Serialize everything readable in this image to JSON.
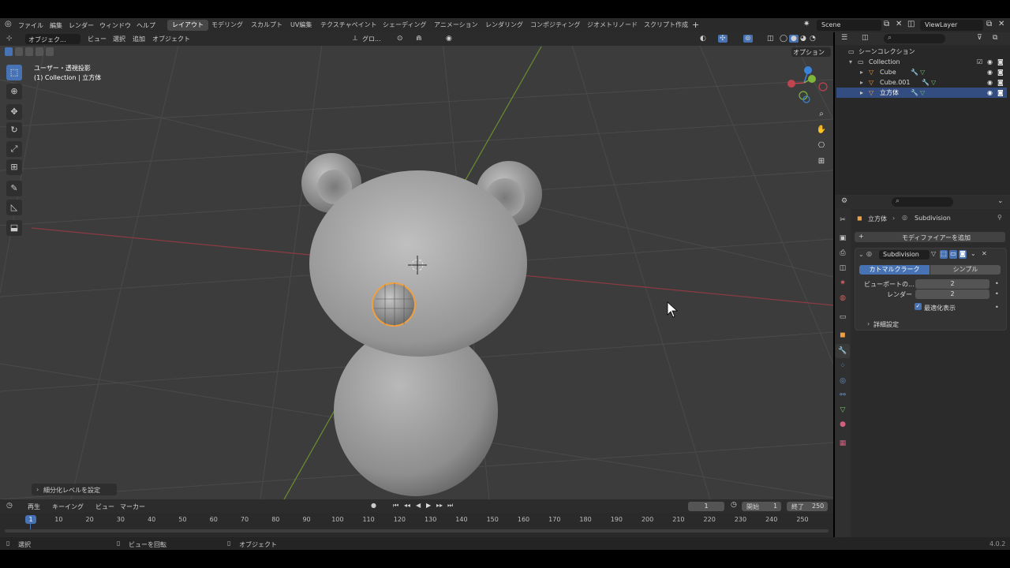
{
  "menu": [
    "ファイル",
    "編集",
    "レンダー",
    "ウィンドウ",
    "ヘルプ"
  ],
  "workspaces": [
    "レイアウト",
    "モデリング",
    "スカルプト",
    "UV編集",
    "テクスチャペイント",
    "シェーディング",
    "アニメーション",
    "レンダリング",
    "コンポジティング",
    "ジオメトリノード",
    "スクリプト作成"
  ],
  "workspace_add": "+",
  "scene": "Scene",
  "view_layer": "ViewLayer",
  "viewport": {
    "mode": "オブジェク...",
    "menus": [
      "ビュー",
      "選択",
      "追加",
      "オブジェクト"
    ],
    "orientation": "グロ...",
    "options": "オプション",
    "info_line1": "ユーザー・透視投影",
    "info_line2": "(1) Collection | 立方体",
    "operator_panel": "細分化レベルを設定"
  },
  "outliner": {
    "scene_collection": "シーンコレクション",
    "collection": "Collection",
    "objects": [
      "Cube",
      "Cube.001",
      "立方体"
    ]
  },
  "properties": {
    "breadcrumb_object": "立方体",
    "breadcrumb_modifier": "Subdivision",
    "add_modifier": "モディファイアーを追加",
    "modifier_name": "Subdivision",
    "type_catmull": "カトマルクラーク",
    "type_simple": "シンプル",
    "viewport_label": "ビューポートの...",
    "viewport_value": "2",
    "render_label": "レンダー",
    "render_value": "2",
    "optimal_display": "最適化表示",
    "advanced": "詳細設定"
  },
  "timeline": {
    "menus": [
      "再生",
      "キーイング",
      "ビュー",
      "マーカー"
    ],
    "current_frame": "1",
    "start_label": "開始",
    "start": "1",
    "end_label": "終了",
    "end": "250",
    "ticks": [
      "1",
      "10",
      "20",
      "30",
      "40",
      "50",
      "60",
      "70",
      "80",
      "90",
      "100",
      "110",
      "120",
      "130",
      "140",
      "150",
      "160",
      "170",
      "180",
      "190",
      "200",
      "210",
      "220",
      "230",
      "240",
      "250"
    ]
  },
  "statusbar": {
    "select": "選択",
    "rotate_view": "ビューを回転",
    "object": "オブジェクト",
    "version": "4.0.2"
  },
  "colors": {
    "accent": "#4772b3",
    "selection": "#f0a040",
    "x_axis": "#c0444f",
    "y_axis": "#7fb53a",
    "z_axis": "#3a84d8"
  }
}
